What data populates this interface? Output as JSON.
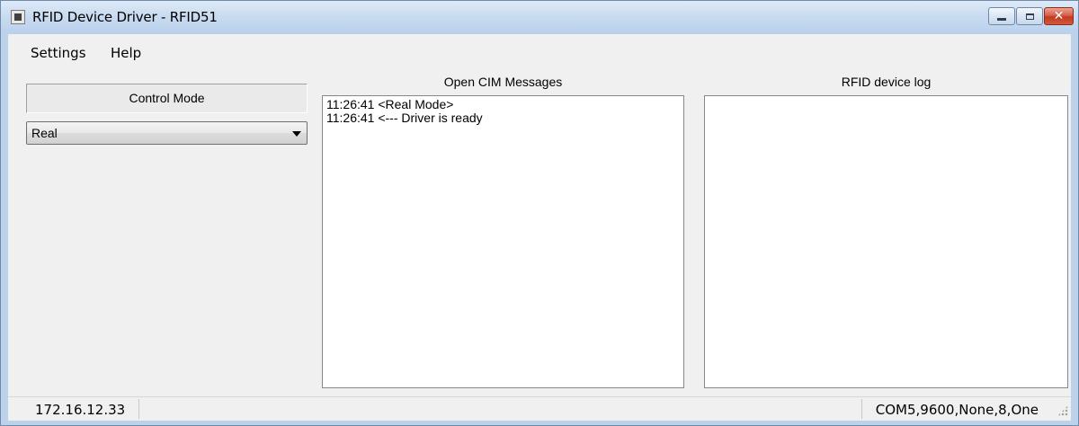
{
  "window": {
    "title": "RFID Device Driver - RFID51"
  },
  "menu": {
    "settings": "Settings",
    "help": "Help"
  },
  "control_mode": {
    "header": "Control Mode",
    "selected": "Real"
  },
  "cim_panel": {
    "title": "Open CIM Messages",
    "lines": [
      "11:26:41 <Real Mode>",
      "11:26:41 <--- Driver is ready"
    ]
  },
  "rfid_panel": {
    "title": "RFID device log",
    "lines": []
  },
  "status": {
    "ip": "172.16.12.33",
    "port_settings": "COM5,9600,None,8,One"
  },
  "icons": {
    "app": "app-icon",
    "minimize": "minimize-icon",
    "maximize": "maximize-icon",
    "close": "close-icon",
    "dropdown": "chevron-down-icon",
    "grip": "resize-grip-icon"
  }
}
